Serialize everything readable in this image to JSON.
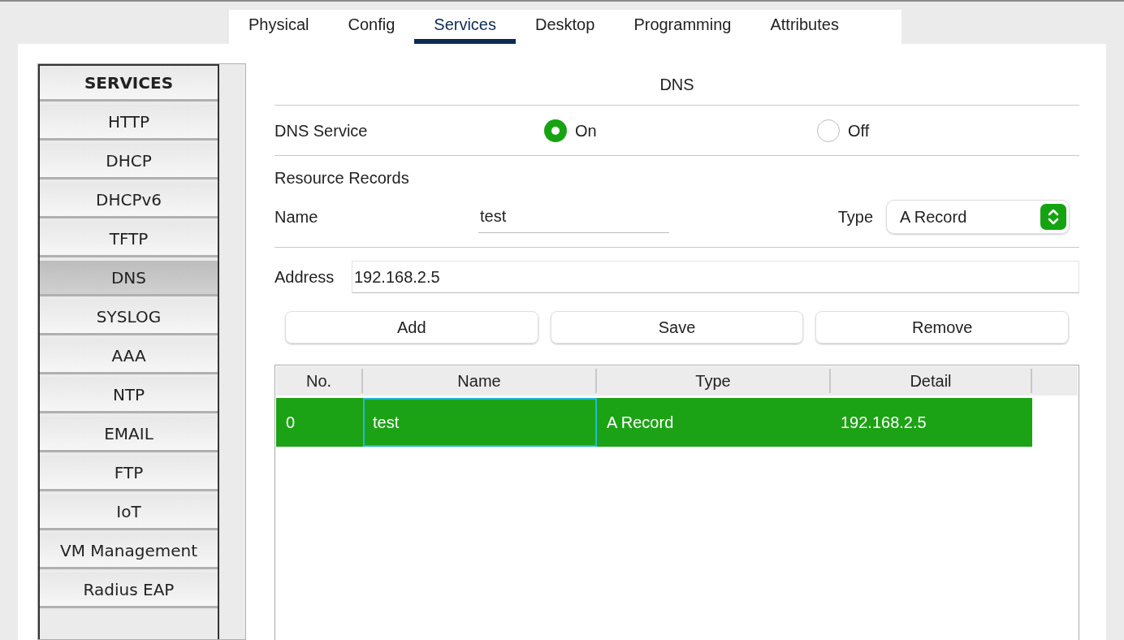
{
  "tabs": [
    {
      "label": "Physical",
      "selected": false
    },
    {
      "label": "Config",
      "selected": false
    },
    {
      "label": "Services",
      "selected": true
    },
    {
      "label": "Desktop",
      "selected": false
    },
    {
      "label": "Programming",
      "selected": false
    },
    {
      "label": "Attributes",
      "selected": false
    }
  ],
  "sidebar": {
    "title": "SERVICES",
    "items": [
      {
        "label": "HTTP",
        "selected": false
      },
      {
        "label": "DHCP",
        "selected": false
      },
      {
        "label": "DHCPv6",
        "selected": false
      },
      {
        "label": "TFTP",
        "selected": false
      },
      {
        "label": "DNS",
        "selected": true
      },
      {
        "label": "SYSLOG",
        "selected": false
      },
      {
        "label": "AAA",
        "selected": false
      },
      {
        "label": "NTP",
        "selected": false
      },
      {
        "label": "EMAIL",
        "selected": false
      },
      {
        "label": "FTP",
        "selected": false
      },
      {
        "label": "IoT",
        "selected": false
      },
      {
        "label": "VM Management",
        "selected": false
      },
      {
        "label": "Radius EAP",
        "selected": false
      }
    ]
  },
  "dns": {
    "title": "DNS",
    "service_label": "DNS Service",
    "service_options": [
      {
        "label": "On",
        "selected": true
      },
      {
        "label": "Off",
        "selected": false
      }
    ],
    "records_label": "Resource Records",
    "name": {
      "label": "Name",
      "value": "test"
    },
    "type": {
      "label": "Type",
      "value": "A Record"
    },
    "address": {
      "label": "Address",
      "value": "192.168.2.5"
    },
    "buttons": [
      "Add",
      "Save",
      "Remove"
    ],
    "table": {
      "columns": [
        "No.",
        "Name",
        "Type",
        "Detail"
      ],
      "rows": [
        {
          "selected": true,
          "cells": [
            {
              "text": "0",
              "focused": false
            },
            {
              "text": "test",
              "focused": true
            },
            {
              "text": "A Record",
              "focused": false
            },
            {
              "text": "192.168.2.5",
              "focused": false
            }
          ]
        }
      ]
    }
  }
}
